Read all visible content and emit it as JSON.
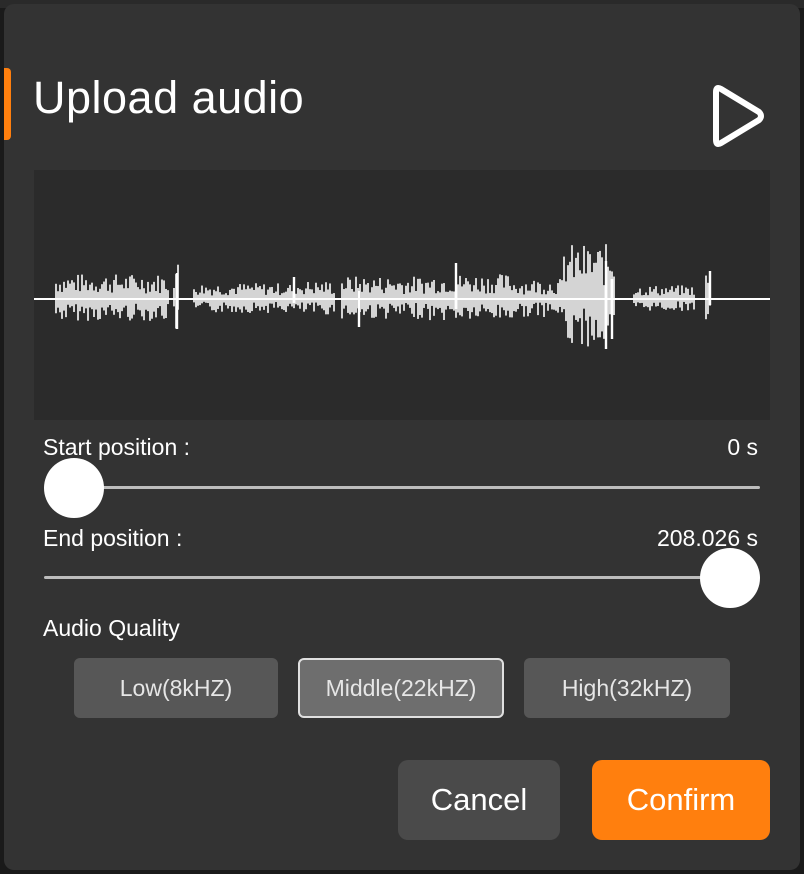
{
  "dialog": {
    "title": "Upload audio",
    "play_icon": "play-icon"
  },
  "start_position": {
    "label": "Start position :",
    "value": "0 s",
    "fraction": 0.0
  },
  "end_position": {
    "label": "End position :",
    "value": "208.026 s",
    "fraction": 1.0
  },
  "audio_quality": {
    "label": "Audio Quality",
    "options": [
      {
        "label": "Low(8kHZ)",
        "selected": false
      },
      {
        "label": "Middle(22kHZ)",
        "selected": true
      },
      {
        "label": "High(32kHZ)",
        "selected": false
      }
    ]
  },
  "actions": {
    "cancel_label": "Cancel",
    "confirm_label": "Confirm"
  },
  "colors": {
    "accent": "#ff7f0e",
    "dialog_bg": "#333333",
    "waveform": "#ffffff",
    "button_bg": "#575757",
    "cancel_bg": "#4a4a4a"
  }
}
